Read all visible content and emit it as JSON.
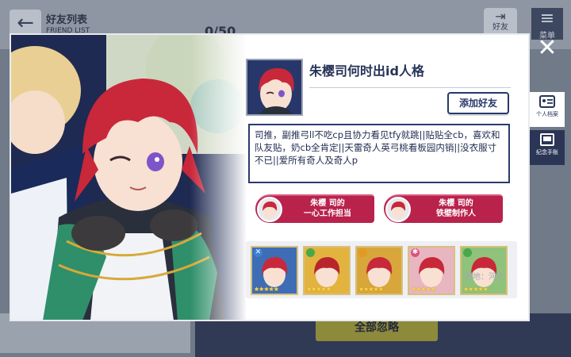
{
  "background": {
    "title": "好友列表",
    "subtitle": "FRIEND LIST",
    "count": "0/50",
    "right_button_label": "好友",
    "menu_label": "菜单",
    "ignore_all_label": "全部忽略"
  },
  "dialog": {
    "username": "朱樱司何时出id人格",
    "add_friend_label": "添加好友",
    "bio": "司推，副推弓ll不吃cp且协力看见tfy就跳||贴贴全cb，喜欢和队友贴，奶cb全肯定||天雷奇人英弓桃看板园内销||没衣服寸不已||爱所有奇人及奇人p",
    "unit_buttons": [
      {
        "label_line1": "朱樱 司的",
        "label_line2": "一心工作担当"
      },
      {
        "label_line1": "朱樱 司的",
        "label_line2": "铁壁制作人"
      }
    ],
    "cards": [
      {
        "attr_icon": "cross-attr-icon",
        "attr_glyph": "✕",
        "attr_color": "#3a82d8",
        "stars": "★★★★★"
      },
      {
        "attr_icon": "leaf-attr-icon",
        "attr_glyph": "",
        "attr_color": "#48a84a",
        "stars": "★★★★★"
      },
      {
        "attr_icon": "sun-attr-icon",
        "attr_glyph": "",
        "attr_color": "#e39a22",
        "stars": "★★★★★"
      },
      {
        "attr_icon": "star-attr-icon",
        "attr_glyph": "✱",
        "attr_color": "#e0507a",
        "stars": "★★★★★"
      },
      {
        "attr_icon": "leaf-attr-icon",
        "attr_glyph": "",
        "attr_color": "#48a84a",
        "stars": "★★★★★"
      }
    ],
    "location": "属地：河北"
  },
  "side_panel": {
    "close_label": "✕",
    "tabs": [
      {
        "label": "个人档案",
        "active": true
      },
      {
        "label": "纪念手账",
        "active": false
      }
    ]
  },
  "colors": {
    "navy": "#273457",
    "unit_red": "#b8224b",
    "overlay_dim": "#707a88",
    "hair_red": "#c8283a"
  }
}
